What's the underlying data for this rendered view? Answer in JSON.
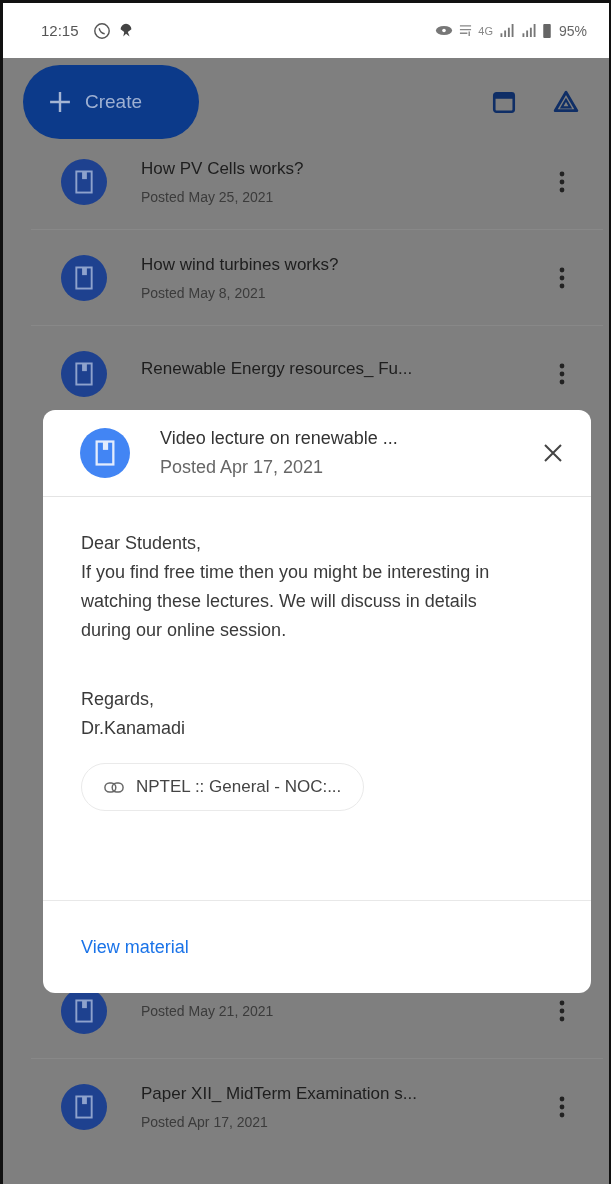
{
  "status_bar": {
    "time": "12:15",
    "network": "4G",
    "battery": "95%"
  },
  "create_button": {
    "label": "Create"
  },
  "materials": [
    {
      "title": "How PV Cells works?",
      "posted": "Posted May 25, 2021"
    },
    {
      "title": "How wind turbines works?",
      "posted": "Posted May 8, 2021"
    },
    {
      "title": "Renewable Energy resources_ Fu..."
    }
  ],
  "materials_below": [
    {
      "posted": "Posted May 21, 2021"
    },
    {
      "title": "Paper XII_ MidTerm Examination s...",
      "posted": "Posted Apr 17, 2021"
    }
  ],
  "dialog": {
    "title": "Video lecture on renewable ...",
    "posted": "Posted Apr 17, 2021",
    "body": [
      "Dear Students,\nIf you find free time then you might be interesting in watching these lectures. We will discuss in details during our online session.",
      "Regards,\nDr.Kanamadi"
    ],
    "attachment": "NPTEL :: General - NOC:...",
    "action": "View material"
  }
}
